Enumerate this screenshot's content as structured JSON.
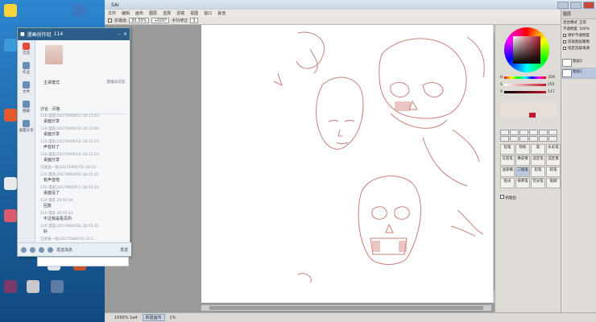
{
  "desktop": {
    "icons": [
      {
        "label": "",
        "color": "#f7d43b"
      },
      {
        "label": "",
        "color": "#3a78c2"
      },
      {
        "label": "",
        "color": "#3d9ad8"
      },
      {
        "label": "",
        "color": "#e45a2b"
      },
      {
        "label": "",
        "color": "#e9eaea"
      },
      {
        "label": "",
        "color": "#d95b6c"
      }
    ],
    "bottom_icons": [
      {
        "label": "",
        "color": "#dfe3e8"
      },
      {
        "label": "",
        "color": "#c7542f"
      },
      {
        "label": "",
        "color": "#7a3a6a"
      },
      {
        "label": "",
        "color": "#c7c9cc"
      },
      {
        "label": "",
        "color": "#5f7ca2"
      }
    ]
  },
  "chat": {
    "title": "漫画创作班",
    "title_count": "114",
    "sidebar": [
      {
        "label": "交流",
        "active": true
      },
      {
        "label": "作业",
        "active": false
      },
      {
        "label": "文件",
        "active": false
      },
      {
        "label": "相册",
        "active": false
      },
      {
        "label": "桌面分享",
        "active": false
      }
    ],
    "mode_label": "主讲模式",
    "mode_right": "管理员可见",
    "msgs_header": "讨论 · 问答",
    "messages": [
      {
        "meta": "110 漫友(2017090001) 20:15:03",
        "text": "桌面分享",
        "sys": false
      },
      {
        "meta": "110 漫友(2017090072) 20:15:04",
        "text": "桌面分享",
        "sys": false
      },
      {
        "meta": "110 漫友(2017090073) 20:15:10",
        "text": "声音好了",
        "sys": false
      },
      {
        "meta": "110 漫友(2017090074) 20:15:14",
        "text": "桌面分享",
        "sys": false
      },
      {
        "meta": "",
        "text": "已发送一张(2017090075) 20:15:",
        "sys": true
      },
      {
        "meta": "110 漫友(2017090076) 20:15:21",
        "text": "有声音啦",
        "sys": false
      },
      {
        "meta": "110 漫友(2017090077) 20:15:24",
        "text": "桌面没了",
        "sys": false
      },
      {
        "meta": "110 漫友 20:15:30",
        "text": "回复",
        "sys": false
      },
      {
        "meta": "110 漫友 20:15:33",
        "text": "不过我是看见的",
        "sys": false
      },
      {
        "meta": "110 漫友(2017090078) 20:15:41",
        "text": "好",
        "sys": false
      },
      {
        "meta": "",
        "text": "已发送一张(2017090079) 20:1",
        "sys": true
      },
      {
        "meta": "",
        "text": "已发送一张(2017090080) 20:1",
        "sys": true
      },
      {
        "meta": "110 漫友(2017090081) 20:16:15",
        "text": "好了",
        "sys": false
      }
    ],
    "bottom_bar_label": "发送消息",
    "bottom_bar_right": "发送"
  },
  "sai": {
    "title": "SAI",
    "menu": [
      "文件",
      "编辑",
      "画布",
      "图层",
      "选择",
      "滤镜",
      "视图",
      "窗口",
      "其他"
    ],
    "toolbar": {
      "zoom": "30.33%",
      "angle": "+000°",
      "antialias_label": "抗锯齿",
      "stabilizer_label": "手抖修正",
      "stabilizer_value": "3"
    },
    "status": {
      "memory": "1000% 1a4",
      "tab": "新建画布",
      "percent": "1%"
    },
    "panel": {
      "hsv": [
        {
          "label": "H",
          "value": "359"
        },
        {
          "label": "S",
          "value": "255"
        },
        {
          "label": "V",
          "value": "117"
        }
      ],
      "brushes": [
        {
          "label": "铅笔",
          "selected": false
        },
        {
          "label": "喷枪",
          "selected": false
        },
        {
          "label": "笔",
          "selected": false
        },
        {
          "label": "水彩笔",
          "selected": false
        },
        {
          "label": "马克笔",
          "selected": false
        },
        {
          "label": "橡皮擦",
          "selected": false
        },
        {
          "label": "选区笔",
          "selected": false
        },
        {
          "label": "选区擦",
          "selected": false
        },
        {
          "label": "油漆桶",
          "selected": false
        },
        {
          "label": "二值笔",
          "selected": true
        },
        {
          "label": "铅笔",
          "selected": false
        },
        {
          "label": "软笔",
          "selected": false
        },
        {
          "label": "指尖",
          "selected": false
        },
        {
          "label": "抹茶笔",
          "selected": false
        },
        {
          "label": "荧光笔",
          "selected": false
        },
        {
          "label": "笔刷",
          "selected": false
        }
      ],
      "checkbox_label": "抗锯齿"
    },
    "layers": {
      "header": "图层",
      "rows": [
        {
          "label": "混合模式",
          "value": "正常"
        },
        {
          "label": "不透明度",
          "value": "100%"
        },
        {
          "label": "保护不透明度",
          "value": ""
        },
        {
          "label": "剪贴图层蒙版",
          "value": ""
        },
        {
          "label": "指定选取来源",
          "value": ""
        }
      ],
      "items": [
        {
          "name": "图层2",
          "selected": false
        },
        {
          "name": "图层1",
          "selected": true
        }
      ]
    }
  }
}
